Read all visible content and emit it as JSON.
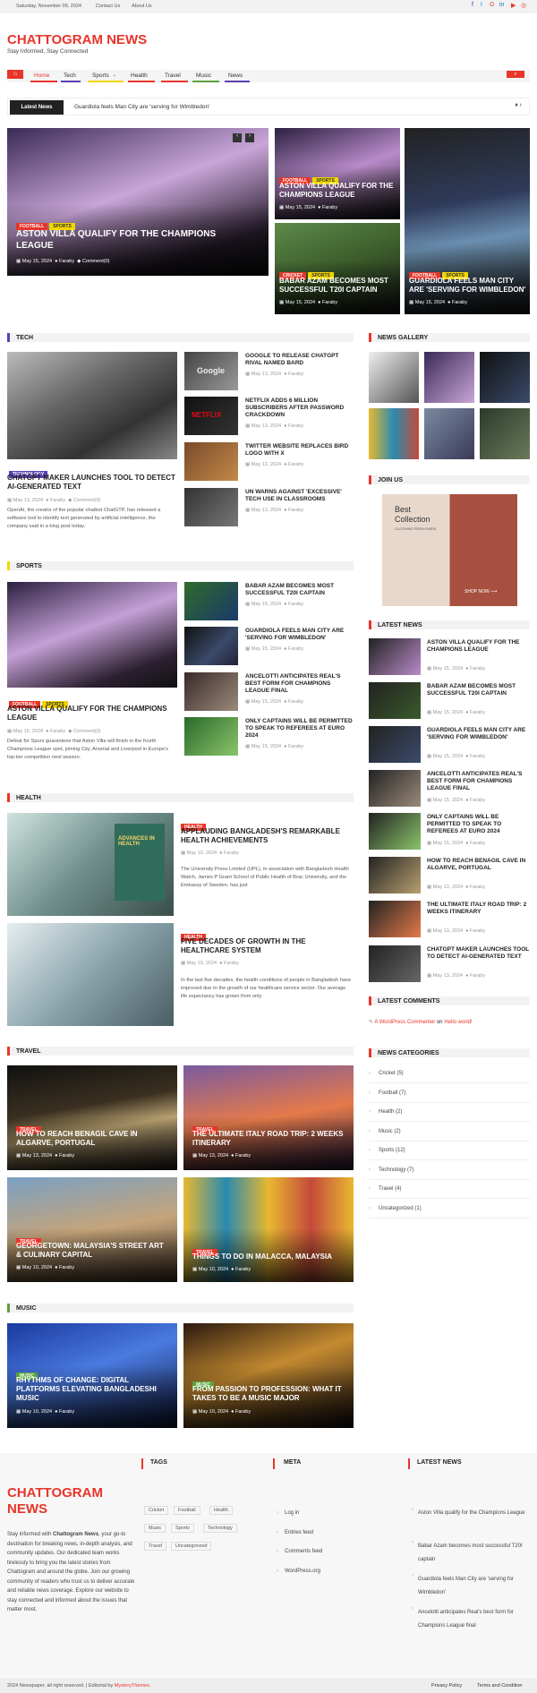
{
  "topbar": {
    "date": "Saturday, November 09, 2024",
    "links": [
      "Contact Us",
      "About Us"
    ]
  },
  "site": {
    "title": "CHATTOGRAM NEWS",
    "tagline": "Stay Informed, Stay Connected"
  },
  "nav": {
    "items": [
      "Home",
      "Tech",
      "Sports",
      "Health",
      "Travel",
      "Music",
      "News"
    ]
  },
  "ticker": {
    "label": "Latest News",
    "text": "Guardiola feels Man City are 'serving for Wimbledon'"
  },
  "hero": {
    "main": {
      "cats": [
        "FOOTBALL",
        "SPORTS"
      ],
      "title": "ASTON VILLA QUALIFY FOR THE CHAMPIONS LEAGUE",
      "date": "May 15, 2024",
      "author": "Faraby",
      "comments": "Comment(0)"
    },
    "side": [
      {
        "cats": [
          "FOOTBALL",
          "SPORTS"
        ],
        "title": "ASTON VILLA QUALIFY FOR THE CHAMPIONS LEAGUE",
        "date": "May 15, 2024",
        "author": "Faraby"
      },
      {
        "cats": [
          "CRICKET",
          "SPORTS"
        ],
        "title": "BABAR AZAM BECOMES MOST SUCCESSFUL T20I CAPTAIN",
        "date": "May 15, 2024",
        "author": "Faraby"
      },
      {
        "cats": [
          "FOOTBALL",
          "SPORTS"
        ],
        "title": "GUARDIOLA FEELS MAN CITY ARE 'SERVING FOR WIMBLEDON'",
        "date": "May 15, 2024",
        "author": "Faraby"
      }
    ]
  },
  "tech": {
    "label": "TECH",
    "main": {
      "cat": "TECHNOLOGY",
      "title": "CHATGPT MAKER LAUNCHES TOOL TO DETECT AI-GENERATED TEXT",
      "date": "May 13, 2024",
      "author": "Faraby",
      "comments": "Comment(0)",
      "excerpt": "OpenAI, the creator of the popular chatbot ChatGTP, has released a software tool to identify text generated by artificial intelligence, the company said in a blog post today."
    },
    "list": [
      {
        "title": "GOOGLE TO RELEASE CHATGPT RIVAL NAMED BARD",
        "date": "May 13, 2024",
        "author": "Faraby"
      },
      {
        "title": "NETFLIX ADDS 6 MILLION SUBSCRIBERS AFTER PASSWORD CRACKDOWN",
        "date": "May 13, 2024",
        "author": "Faraby"
      },
      {
        "title": "TWITTER WEBSITE REPLACES BIRD LOGO WITH X",
        "date": "May 13, 2024",
        "author": "Faraby"
      },
      {
        "title": "UN WARNS AGAINST 'EXCESSIVE' TECH USE IN CLASSROOMS",
        "date": "May 13, 2024",
        "author": "Faraby"
      }
    ]
  },
  "sports": {
    "label": "SPORTS",
    "main": {
      "cats": [
        "FOOTBALL",
        "SPORTS"
      ],
      "title": "ASTON VILLA QUALIFY FOR THE CHAMPIONS LEAGUE",
      "date": "May 15, 2024",
      "author": "Faraby",
      "comments": "Comment(0)",
      "excerpt": "Defeat for Spurs guarantees that Aston Villa will finish in the fourth Champions League spot, joining City, Arsenal and Liverpool in Europe's top-tier competition next season."
    },
    "list": [
      {
        "title": "BABAR AZAM BECOMES MOST SUCCESSFUL T20I CAPTAIN",
        "date": "May 15, 2024",
        "author": "Faraby"
      },
      {
        "title": "GUARDIOLA FEELS MAN CITY ARE 'SERVING FOR WIMBLEDON'",
        "date": "May 15, 2024",
        "author": "Faraby"
      },
      {
        "title": "ANCELOTTI ANTICIPATES REAL'S BEST FORM FOR CHAMPIONS LEAGUE FINAL",
        "date": "May 15, 2024",
        "author": "Faraby"
      },
      {
        "title": "ONLY CAPTAINS WILL BE PERMITTED TO SPEAK TO REFEREES AT EURO 2024",
        "date": "May 15, 2024",
        "author": "Faraby"
      }
    ]
  },
  "health": {
    "label": "HEALTH",
    "items": [
      {
        "cat": "HEALTH",
        "title": "APPLAUDING BANGLADESH'S REMARKABLE HEALTH ACHIEVEMENTS",
        "date": "May 10, 2024",
        "author": "Faraby",
        "excerpt": "The University Press Limited (UPL), in association with Bangladesh Health Watch, James P Grant School of Public Health of Brac University, and the Embassy of Sweden, has just"
      },
      {
        "cat": "HEALTH",
        "title": "FIVE DECADES OF GROWTH IN THE HEALTHCARE SYSTEM",
        "date": "May 10, 2024",
        "author": "Faraby",
        "excerpt": "In the last five decades, the health conditions of people in Bangladesh have improved due to the growth of our healthcare service sector. Our average life expectancy has grown from only"
      }
    ],
    "book": "ADVANCES IN HEALTH"
  },
  "travel": {
    "label": "TRAVEL",
    "items": [
      {
        "cat": "TRAVEL",
        "title": "HOW TO REACH BENAGIL CAVE IN ALGARVE, PORTUGAL",
        "date": "May 13, 2024",
        "author": "Faraby"
      },
      {
        "cat": "TRAVEL",
        "title": "THE ULTIMATE ITALY ROAD TRIP: 2 WEEKS ITINERARY",
        "date": "May 13, 2024",
        "author": "Faraby"
      },
      {
        "cat": "TRAVEL",
        "title": "GEORGETOWN: MALAYSIA'S STREET ART & CULINARY CAPITAL",
        "date": "May 10, 2024",
        "author": "Faraby"
      },
      {
        "cat": "TRAVEL",
        "title": "THINGS TO DO IN MALACCA, MALAYSIA",
        "date": "May 10, 2024",
        "author": "Faraby"
      }
    ]
  },
  "music": {
    "label": "MUSIC",
    "items": [
      {
        "cat": "MUSIC",
        "title": "RHYTHMS OF CHANGE: DIGITAL PLATFORMS ELEVATING BANGLADESHI MUSIC",
        "date": "May 10, 2024",
        "author": "Faraby"
      },
      {
        "cat": "MUSIC",
        "title": "FROM PASSION TO PROFESSION: WHAT IT TAKES TO BE A MUSIC MAJOR",
        "date": "May 10, 2024",
        "author": "Faraby"
      }
    ]
  },
  "sidebar": {
    "gallery": "NEWS GALLERY",
    "join": "JOIN US",
    "ad": {
      "t1": "Best",
      "t2": "Collection",
      "t3": "CLOTHING FROM PARIS",
      "btn": "SHOP NOW ⟶"
    },
    "latest": "LATEST NEWS",
    "latest_items": [
      {
        "title": "ASTON VILLA QUALIFY FOR THE CHAMPIONS LEAGUE",
        "date": "May 15, 2024",
        "author": "Faraby"
      },
      {
        "title": "BABAR AZAM BECOMES MOST SUCCESSFUL T20I CAPTAIN",
        "date": "May 15, 2024",
        "author": "Faraby"
      },
      {
        "title": "GUARDIOLA FEELS MAN CITY ARE 'SERVING FOR WIMBLEDON'",
        "date": "May 15, 2024",
        "author": "Faraby"
      },
      {
        "title": "ANCELOTTI ANTICIPATES REAL'S BEST FORM FOR CHAMPIONS LEAGUE FINAL",
        "date": "May 15, 2024",
        "author": "Faraby"
      },
      {
        "title": "ONLY CAPTAINS WILL BE PERMITTED TO SPEAK TO REFEREES AT EURO 2024",
        "date": "May 15, 2024",
        "author": "Faraby"
      },
      {
        "title": "HOW TO REACH BENAGIL CAVE IN ALGARVE, PORTUGAL",
        "date": "May 13, 2024",
        "author": "Faraby"
      },
      {
        "title": "THE ULTIMATE ITALY ROAD TRIP: 2 WEEKS ITINERARY",
        "date": "May 13, 2024",
        "author": "Faraby"
      },
      {
        "title": "CHATGPT MAKER LAUNCHES TOOL TO DETECT AI-GENERATED TEXT",
        "date": "May 13, 2024",
        "author": "Faraby"
      }
    ],
    "comments": "LATEST COMMENTS",
    "comment": {
      "author": "A WordPress Commenter",
      "on": "on",
      "post": "Hello world!"
    },
    "cats": "NEWS CATEGORIES",
    "cat_items": [
      "Cricket (5)",
      "Football (7)",
      "Health (2)",
      "Music (2)",
      "Sports (12)",
      "Technology (7)",
      "Travel (4)",
      "Uncategorized (1)"
    ]
  },
  "footer": {
    "brand": "CHATTOGRAM NEWS",
    "about_pre": "Stay informed with ",
    "about_brand": "Chattogram News",
    "about_rest": ", your go-to destination for breaking news, in-depth analysis, and community updates. Our dedicated team works tirelessly to bring you the latest stories from Chattogram and around the globe. Join our growing community of readers who trust us to deliver accurate and reliable news coverage. Explore our website to stay connected and informed about the issues that matter most.",
    "tags_h": "TAGS",
    "tags": [
      "Cricket",
      "Football",
      "Health",
      "Music",
      "Sports",
      "Technology",
      "Travel",
      "Uncategorized"
    ],
    "meta_h": "META",
    "meta": [
      "Log in",
      "Entries feed",
      "Comments feed",
      "WordPress.org"
    ],
    "latest_h": "LATEST NEWS",
    "latest": [
      "Aston Villa qualify for the Champions League",
      "Babar Azam becomes most successful T20I captain",
      "Guardiola feels Man City are 'serving for Wimbledon'",
      "Ancelotti anticipates Real's best form for Champions League final"
    ],
    "copy": "2024 Newspaper, all right reserved. | Editorial by ",
    "copy_link": "MysteryThemes.",
    "links": [
      "Privacy Policy",
      "Terms and Condition"
    ]
  },
  "colors": {
    "accent": "#e8352a",
    "dark": "#222222",
    "yellow": "#f2d600",
    "green": "#5aa13c",
    "purple": "#5a3fb4"
  }
}
